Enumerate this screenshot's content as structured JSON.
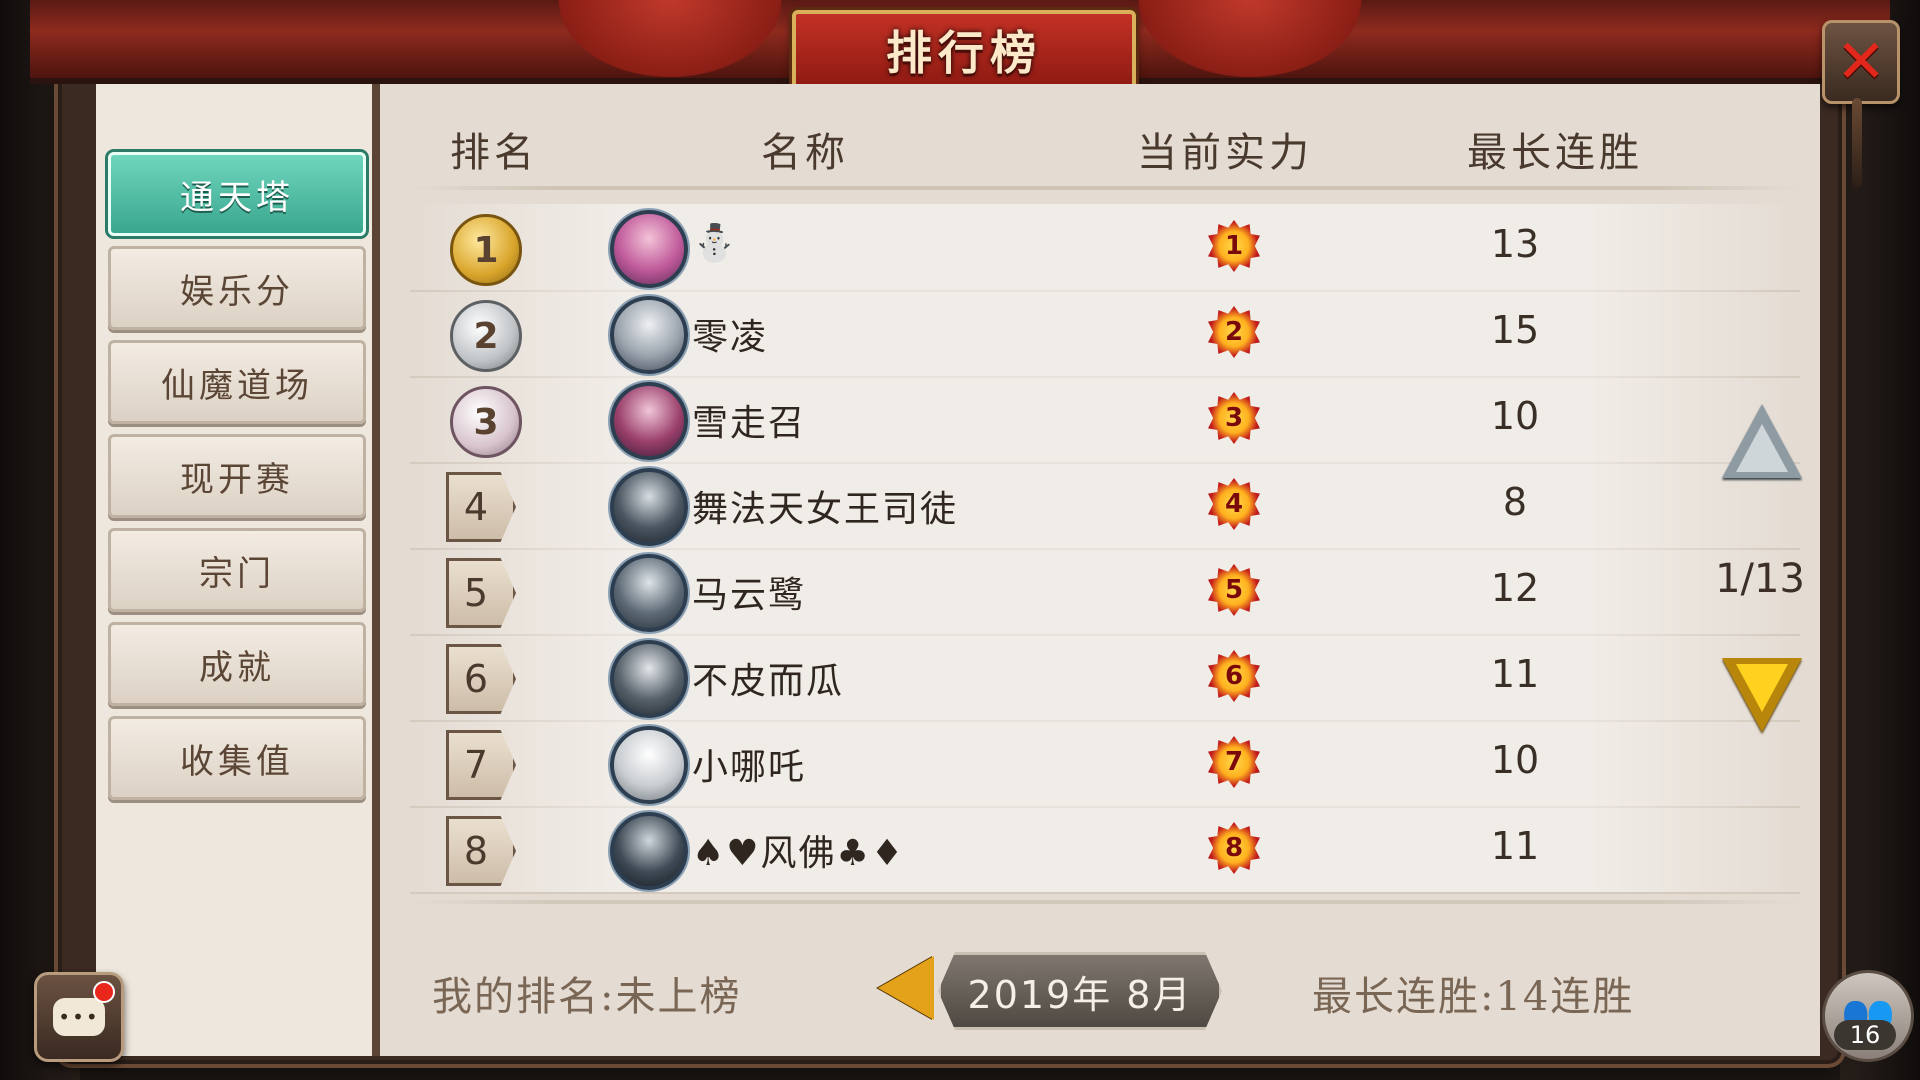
{
  "window": {
    "title": "排行榜",
    "close_icon": "close-icon"
  },
  "sidebar": {
    "tabs": [
      {
        "label": "通天塔",
        "active": true
      },
      {
        "label": "娱乐分",
        "active": false
      },
      {
        "label": "仙魔道场",
        "active": false
      },
      {
        "label": "现开赛",
        "active": false
      },
      {
        "label": "宗门",
        "active": false
      },
      {
        "label": "成就",
        "active": false
      },
      {
        "label": "收集值",
        "active": false
      }
    ]
  },
  "table": {
    "headers": {
      "rank": "排名",
      "name": "名称",
      "power": "当前实力",
      "streak": "最长连胜"
    },
    "rows": [
      {
        "rank": "1",
        "name": "",
        "emoji": "⛄",
        "power": "1",
        "streak": "13",
        "avatar_color": "#c05a9a"
      },
      {
        "rank": "2",
        "name": "零凌",
        "emoji": "",
        "power": "2",
        "streak": "15",
        "avatar_color": "#9aa3ad"
      },
      {
        "rank": "3",
        "name": "雪走召",
        "emoji": "",
        "power": "3",
        "streak": "10",
        "avatar_color": "#9a3f6b"
      },
      {
        "rank": "4",
        "name": "舞法天女王司徒",
        "emoji": "",
        "power": "4",
        "streak": "8",
        "avatar_color": "#4a5560"
      },
      {
        "rank": "5",
        "name": "马云鹭",
        "emoji": "",
        "power": "5",
        "streak": "12",
        "avatar_color": "#5d6a76"
      },
      {
        "rank": "6",
        "name": "不皮而瓜",
        "emoji": "",
        "power": "6",
        "streak": "11",
        "avatar_color": "#55606a"
      },
      {
        "rank": "7",
        "name": "小哪吒",
        "emoji": "",
        "power": "7",
        "streak": "10",
        "avatar_color": "#c9cdd1"
      },
      {
        "rank": "8",
        "name": "♠♥风佛♣♦",
        "emoji": "",
        "power": "8",
        "streak": "11",
        "avatar_color": "#3f4a55"
      }
    ]
  },
  "pager": {
    "indicator": "1/13",
    "up_icon": "arrow-up-icon",
    "down_icon": "arrow-down-icon"
  },
  "footer": {
    "my_rank": "我的排名:未上榜",
    "month": "2019年  8月",
    "best_streak": "最长连胜:14连胜"
  },
  "chat": {
    "icon": "chat-icon",
    "text": "•••"
  },
  "friends": {
    "count": "16",
    "icon": "friends-icon"
  }
}
